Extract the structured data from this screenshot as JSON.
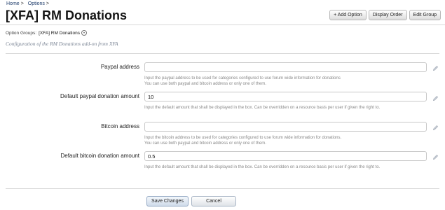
{
  "breadcrumb": {
    "items": [
      "Home",
      "Options"
    ],
    "separator": ">"
  },
  "page": {
    "title": "[XFA] RM Donations"
  },
  "toolbar": {
    "add_option": "+ Add Option",
    "display_order": "Display Order",
    "edit_group": "Edit Group"
  },
  "option_groups": {
    "label": "Option Groups:",
    "value": "[XFA] RM Donations"
  },
  "description": "Configuration of the RM Donations add-on from XFA",
  "fields": [
    {
      "label": "Paypal address",
      "value": "",
      "hint": "Input the paypal address to be used for categories configured to use forum wide information for donations\nYou can use both paypal and bitcoin address or only one of them."
    },
    {
      "label": "Default paypal donation amount",
      "value": "10",
      "hint": "Input the default amount that shall be displayed in the box. Can be overridden on a resource basis per user if given the right to."
    },
    {
      "label": "Bitcoin address",
      "value": "",
      "hint": "Input the bitcoin address to be used for categories configured to use forum wide information for donations.\nYou can use both paypal and bitcoin address or only one of them."
    },
    {
      "label": "Default bitcoin donation amount",
      "value": "0.5",
      "hint": "Input the default amount that shall be displayed in the box. Can be overridden on a resource basis per user if given the right to."
    }
  ],
  "footer": {
    "save_label": "Save Changes",
    "cancel_label": "Cancel"
  },
  "icons": {
    "field_edit": "pencil-icon",
    "option_groups_toggle": "chevron-down-icon"
  }
}
